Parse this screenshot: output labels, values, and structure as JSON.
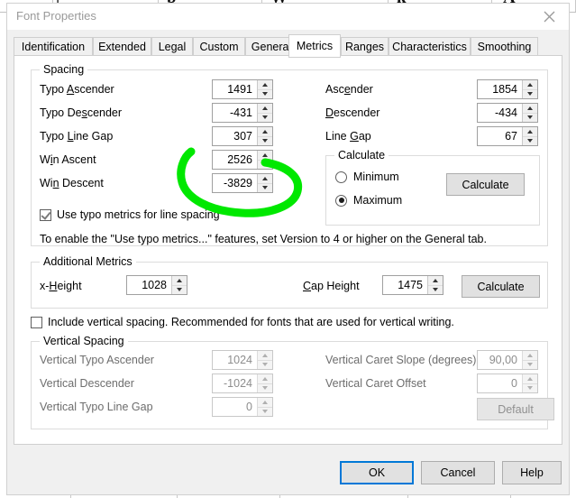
{
  "window": {
    "title": "Font Properties",
    "close_icon": "close-icon"
  },
  "tabs": [
    {
      "label": "Identification",
      "active": false
    },
    {
      "label": "Extended",
      "active": false
    },
    {
      "label": "Legal",
      "active": false
    },
    {
      "label": "Custom",
      "active": false
    },
    {
      "label": "General",
      "active": false
    },
    {
      "label": "Metrics",
      "active": true
    },
    {
      "label": "Ranges",
      "active": false
    },
    {
      "label": "Characteristics",
      "active": false
    },
    {
      "label": "Smoothing",
      "active": false
    }
  ],
  "spacing": {
    "title": "Spacing",
    "left_fields": [
      {
        "label_pre": "Typo ",
        "label_accel": "A",
        "label_post": "scender",
        "value": "1491"
      },
      {
        "label_pre": "Typo De",
        "label_accel": "s",
        "label_post": "cender",
        "value": "-431"
      },
      {
        "label_pre": "Typo ",
        "label_accel": "L",
        "label_post": "ine Gap",
        "value": "307"
      },
      {
        "label_pre": "W",
        "label_accel": "i",
        "label_post": "n Ascent",
        "value": "2526"
      },
      {
        "label_pre": "Wi",
        "label_accel": "n",
        "label_post": " Descent",
        "value": "-3829"
      }
    ],
    "right_fields": [
      {
        "label_pre": "Asc",
        "label_accel": "e",
        "label_post": "nder",
        "value": "1854"
      },
      {
        "label_pre": "",
        "label_accel": "D",
        "label_post": "escender",
        "value": "-434"
      },
      {
        "label_pre": "Line ",
        "label_accel": "G",
        "label_post": "ap",
        "value": "67"
      }
    ],
    "calculate_group": {
      "title": "Calculate",
      "options": [
        {
          "label": "Minimum",
          "selected": false
        },
        {
          "label": "Maximum",
          "selected": true
        }
      ],
      "button_label": "Calculate"
    },
    "use_typo_checkbox": {
      "label": "Use typo metrics for line spacing",
      "checked": true
    },
    "hint": "To enable the \"Use typo metrics...\" features, set Version to 4 or higher on the General tab."
  },
  "additional_metrics": {
    "title": "Additional Metrics",
    "x_height": {
      "label_pre": "x-",
      "label_accel": "H",
      "label_post": "eight",
      "value": "1028"
    },
    "cap_height": {
      "label_pre": "",
      "label_accel": "C",
      "label_post": "ap Height",
      "value": "1475"
    },
    "button_label": "Calculate"
  },
  "include_vertical": {
    "label": "Include vertical spacing. Recommended for fonts that are used for vertical writing.",
    "checked": false
  },
  "vertical_spacing": {
    "title": "Vertical Spacing",
    "left_fields": [
      {
        "label": "Vertical Typo Ascender",
        "value": "1024"
      },
      {
        "label": "Vertical Descender",
        "value": "-1024"
      },
      {
        "label": "Vertical Typo Line Gap",
        "value": "0"
      }
    ],
    "right_fields": [
      {
        "label": "Vertical Caret Slope (degrees)",
        "value": "90,00"
      },
      {
        "label": "Vertical Caret Offset",
        "value": "0"
      }
    ],
    "default_button_label": "Default"
  },
  "footer": {
    "ok_label": "OK",
    "cancel_label": "Cancel",
    "help_label": "Help"
  },
  "annotation": {
    "type": "hand-drawn-oval",
    "color": "#00e800",
    "target": "win-descent-field"
  }
}
